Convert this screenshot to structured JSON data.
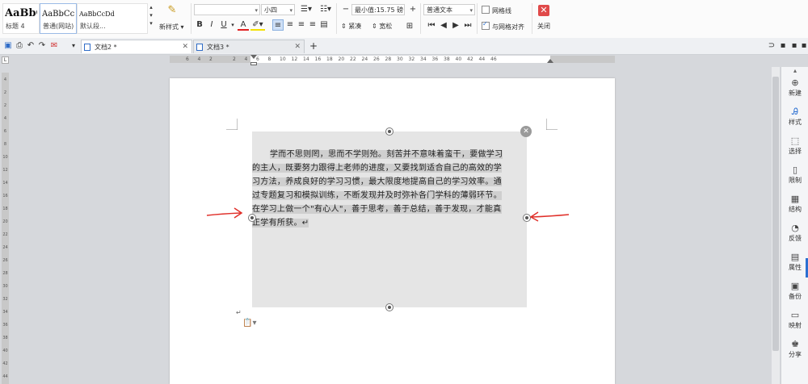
{
  "ribbon": {
    "styles": [
      {
        "sample": "AaBbC",
        "name": "标题 4"
      },
      {
        "sample": "AaBbCcI",
        "name": "普通(网站)"
      },
      {
        "sample": "AaBbCcDd",
        "name": "默认段..."
      }
    ],
    "new_style_label": "新样式",
    "font_name": "",
    "font_size": "小四",
    "line_spacing": "最小值:15.75 磅",
    "paragraph_style": "普通文本",
    "tight_label": "紧凑",
    "loose_label": "宽松",
    "gridline_label": "网格线",
    "align_grid_label": "与网格对齐",
    "close_label": "关闭",
    "bold": "B",
    "italic": "I",
    "underline": "U",
    "font_color_glyph": "A"
  },
  "tabs": [
    {
      "label": "文档2 *",
      "active": true
    },
    {
      "label": "文档3 *",
      "active": false
    }
  ],
  "ruler": {
    "h_ticks": [
      "6",
      "4",
      "2",
      "",
      "2",
      "4",
      "6",
      "8",
      "10",
      "12",
      "14",
      "16",
      "18",
      "20",
      "22",
      "24",
      "26",
      "28",
      "30",
      "32",
      "34",
      "36",
      "38",
      "40",
      "42",
      "44",
      "46"
    ],
    "v_ticks": [
      "4",
      "2",
      "2",
      "4",
      "6",
      "8",
      "10",
      "12",
      "14",
      "16",
      "18",
      "20",
      "22",
      "24",
      "26",
      "28",
      "30",
      "32",
      "34",
      "36",
      "38",
      "40",
      "42",
      "44"
    ]
  },
  "document": {
    "textbox_lines": [
      "学而不思则罔，思而不学则殆。刻苦并不意味着蛮干，要做学习",
      "的主人，既要努力跟得上老师的进度，又要找到适合自己的高效的学",
      "习方法，养成良好的学习习惯，最大限度地提高自己的学习效率。通",
      "过专题复习和模拟训练，不断发现并及时弥补各门学科的薄弱环节。",
      "在学习上做一个\"有心人\"，善于思考，善于总结，善于发现，才能真",
      "正学有所获。↵"
    ],
    "paragraph_mark": "↵"
  },
  "right_panel": [
    {
      "label": "新建",
      "icon": "plus-icon"
    },
    {
      "label": "样式",
      "icon": "style-icon"
    },
    {
      "label": "选择",
      "icon": "select-icon"
    },
    {
      "label": "限制",
      "icon": "restrict-icon"
    },
    {
      "label": "结构",
      "icon": "structure-icon"
    },
    {
      "label": "反馈",
      "icon": "feedback-icon"
    },
    {
      "label": "属性",
      "icon": "properties-icon"
    },
    {
      "label": "备份",
      "icon": "backup-icon"
    },
    {
      "label": "映射",
      "icon": "mapping-icon"
    },
    {
      "label": "分享",
      "icon": "share-icon"
    }
  ],
  "colors": {
    "accent": "#2b6fd1",
    "annotation_red": "#e0302a",
    "close_red": "#e04a4a"
  }
}
